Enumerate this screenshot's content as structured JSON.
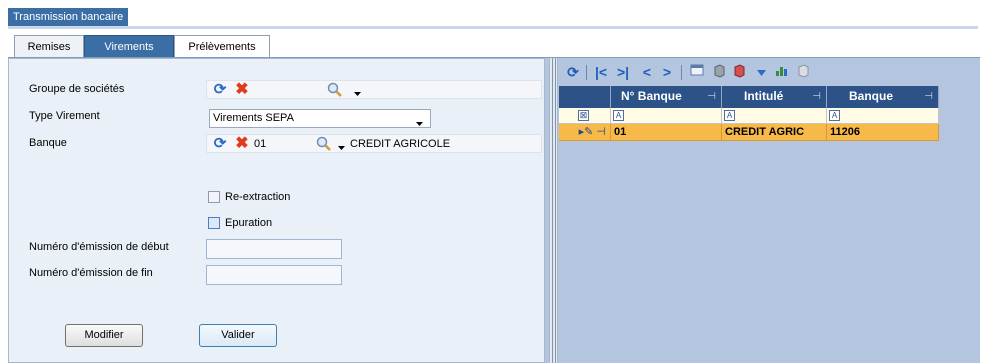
{
  "window": {
    "title": "Transmission bancaire"
  },
  "tabs": [
    {
      "label": "Remises",
      "active": false
    },
    {
      "label": "Virements",
      "active": true
    },
    {
      "label": "Prélèvements",
      "active": false
    }
  ],
  "form": {
    "groupe_label": "Groupe de sociétés",
    "type_label": "Type Virement",
    "type_value": "Virements SEPA",
    "banque_label": "Banque",
    "banque_code": "01",
    "banque_name": "CREDIT AGRICOLE",
    "reextraction_label": "Re-extraction",
    "epuration_label": "Epuration",
    "num_debut_label": "Numéro d'émission de début",
    "num_fin_label": "Numéro d'émission de fin",
    "num_debut_value": "",
    "num_fin_value": ""
  },
  "buttons": {
    "modifier": "Modifier",
    "valider": "Valider"
  },
  "grid": {
    "columns": [
      "N° Banque",
      "Intitulé",
      "Banque"
    ],
    "rows": [
      [
        "01",
        "CREDIT AGRIC",
        "11206"
      ]
    ]
  },
  "colors": {
    "accent": "#3a6ea5",
    "grid_header": "#2c5287",
    "selected_row": "#f6b94a",
    "panel_bg": "#b4c6df"
  }
}
